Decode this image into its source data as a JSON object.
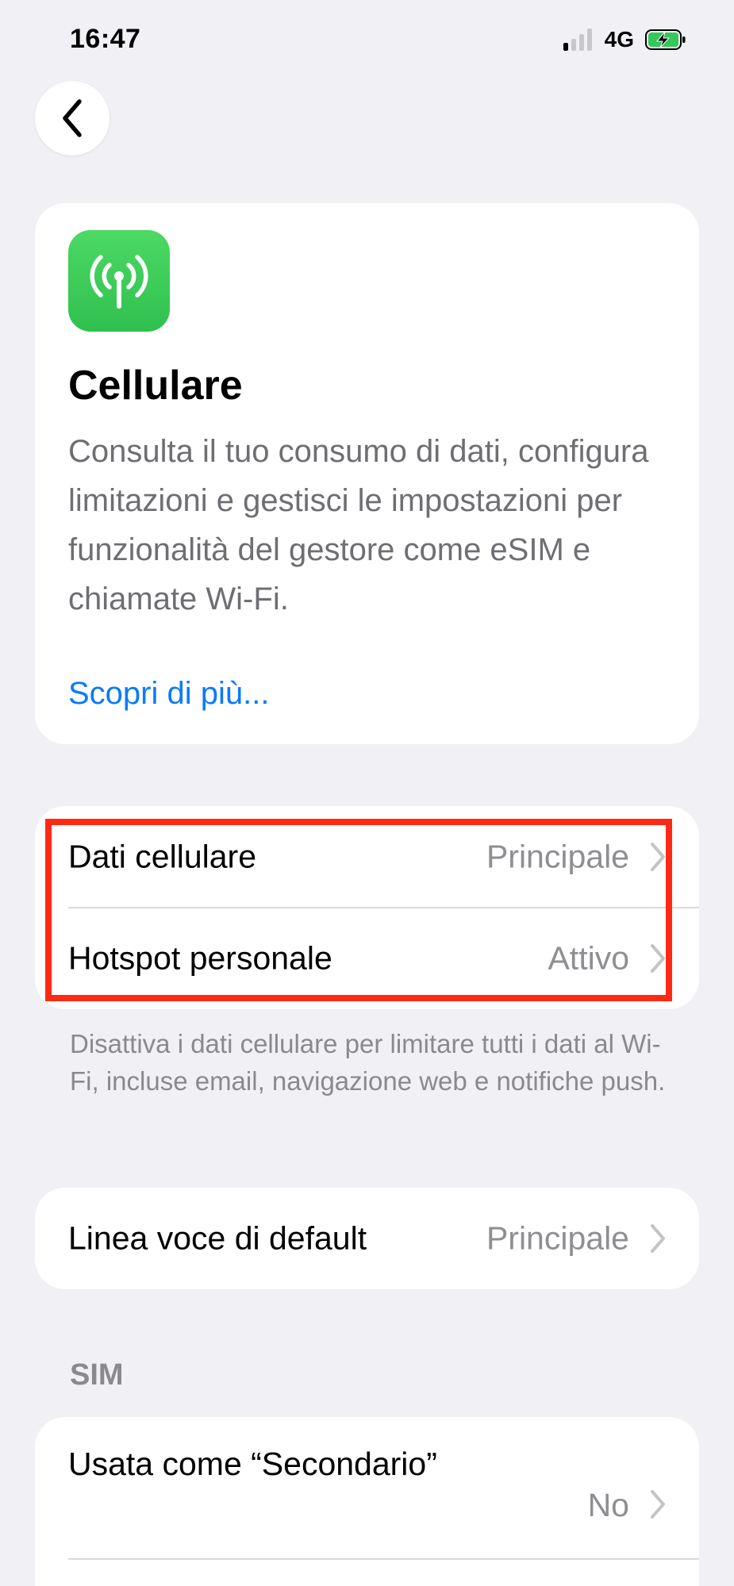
{
  "status_bar": {
    "time": "16:47",
    "network": "4G",
    "signal_bars_active": 1,
    "signal_bars_total": 4,
    "battery_charging": true
  },
  "navigation": {
    "back_icon": "chevron-left-icon"
  },
  "header": {
    "icon": "antenna-signal-icon",
    "icon_color": "#34c759",
    "title": "Cellulare",
    "description": "Consulta il tuo consumo di dati, configura limitazioni e gestisci le impostazioni per funzionalità del gestore come eSIM e chiamate Wi-Fi.",
    "learn_more": "Scopri di più..."
  },
  "cellular_section": {
    "rows": [
      {
        "label": "Dati cellulare",
        "value": "Principale"
      },
      {
        "label": "Hotspot personale",
        "value": "Attivo"
      }
    ],
    "footnote": "Disattiva i dati cellulare per limitare tutti i dati al Wi-Fi, incluse email, navigazione web e notifiche push.",
    "highlight_color": "#ff2a14"
  },
  "voice_section": {
    "rows": [
      {
        "label": "Linea voce di default",
        "value": "Principale"
      }
    ]
  },
  "sim_section": {
    "header": "SIM",
    "rows": [
      {
        "label": "Usata come “Secondario”",
        "value": "No"
      }
    ]
  },
  "colors": {
    "background": "#f0f0f5",
    "card": "#ffffff",
    "link": "#0a7aff",
    "secondary_text": "#8e8e93"
  }
}
